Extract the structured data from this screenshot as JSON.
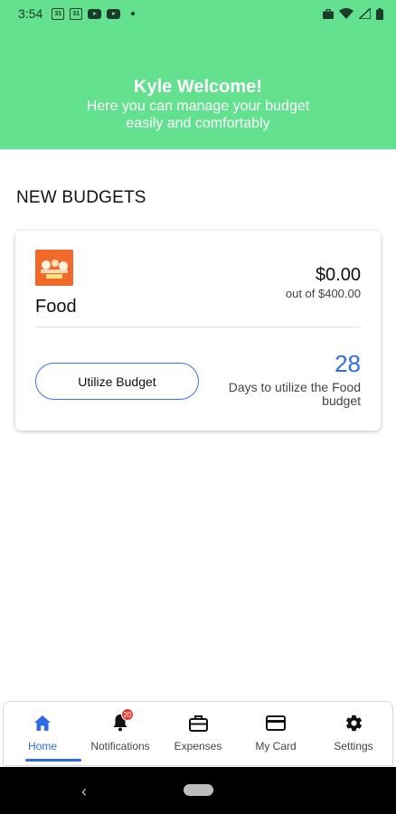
{
  "status_bar": {
    "time": "3:54",
    "calendar_day": "31"
  },
  "header": {
    "title": "Kyle Welcome!",
    "subtitle": "Here you can manage your budget easily and comfortably"
  },
  "section": {
    "title": "NEW BUDGETS"
  },
  "budget_card": {
    "name": "Food",
    "amount": "$0.00",
    "out_of": "out of $400.00",
    "button_label": "Utilize Budget",
    "days_count": "28",
    "days_text": "Days to utilize the Food budget",
    "image_icon": "food-image-icon"
  },
  "bottom_nav": {
    "items": [
      {
        "label": "Home",
        "icon": "home-icon",
        "active": true
      },
      {
        "label": "Notifications",
        "icon": "bell-icon",
        "badge": "20"
      },
      {
        "label": "Expenses",
        "icon": "briefcase-icon"
      },
      {
        "label": "My Card",
        "icon": "credit-card-icon"
      },
      {
        "label": "Settings",
        "icon": "gear-icon"
      }
    ]
  },
  "colors": {
    "header": "#63e18f",
    "accent": "#2f6be8",
    "food_image": "#f26a2a",
    "badge": "#e53935"
  }
}
